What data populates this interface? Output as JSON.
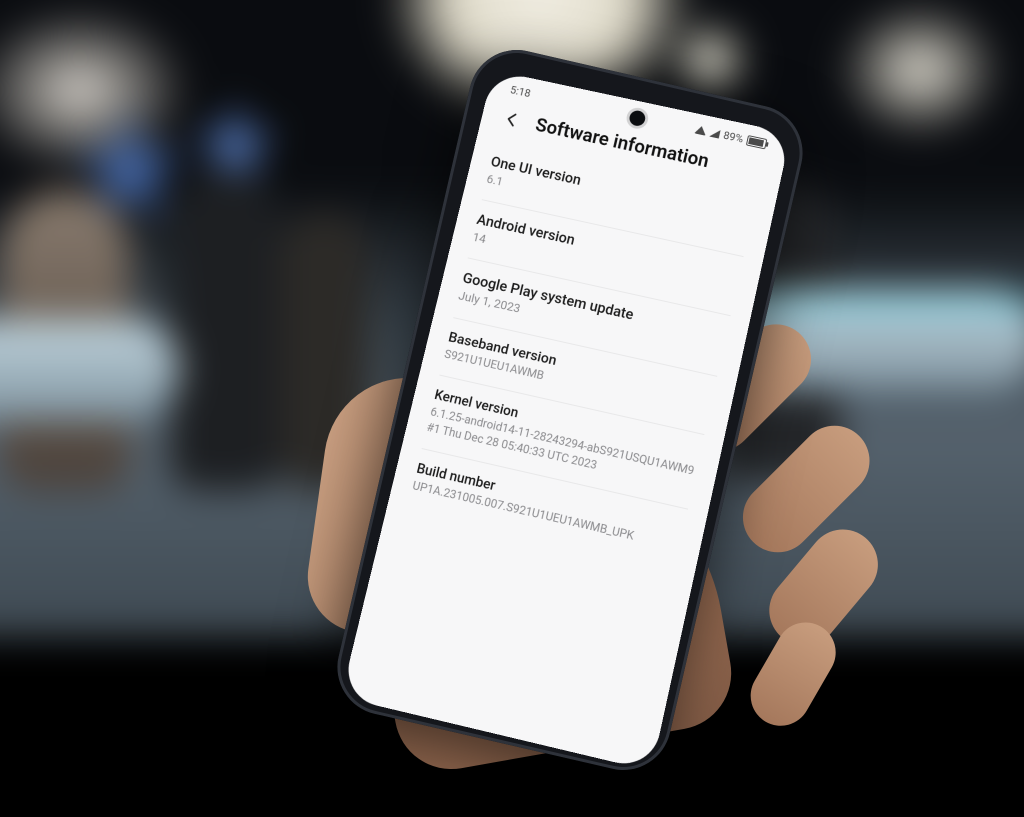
{
  "status_bar": {
    "time": "5:18",
    "battery_pct": "89%"
  },
  "header": {
    "title": "Software information"
  },
  "items": [
    {
      "label": "One UI version",
      "value": "6.1"
    },
    {
      "label": "Android version",
      "value": "14"
    },
    {
      "label": "Google Play system update",
      "value": "July 1, 2023"
    },
    {
      "label": "Baseband version",
      "value": "S921U1UEU1AWMB"
    },
    {
      "label": "Kernel version",
      "value": "6.1.25-android14-11-28243294-abS921USQU1AWM9",
      "value2": "#1 Thu Dec 28 05:40:33 UTC 2023"
    },
    {
      "label": "Build number",
      "value": "UP1A.231005.007.S921U1UEU1AWMB_UPK"
    }
  ]
}
